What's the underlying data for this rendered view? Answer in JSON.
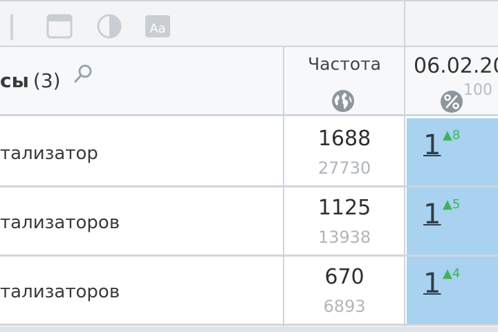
{
  "header": {
    "keywords_label": "сы",
    "keywords_count": "(3)",
    "frequency_label": "Частота",
    "date_label": "06.02.20",
    "percent_label": "100"
  },
  "rows": [
    {
      "keyword": "тализатор",
      "freq_main": "1688",
      "freq_sub": "27730",
      "position": "1",
      "delta": "▲8"
    },
    {
      "keyword": "тализаторов",
      "freq_main": "1125",
      "freq_sub": "13938",
      "position": "1",
      "delta": "▲5"
    },
    {
      "keyword": "тализаторов",
      "freq_main": "670",
      "freq_sub": "6893",
      "position": "1",
      "delta": "▲4"
    }
  ],
  "icons": {
    "toolbar": [
      "window-icon",
      "contrast-icon",
      "font-size-icon"
    ],
    "search": "search-icon",
    "frequency": "globe-icon",
    "percent": "percent-icon"
  },
  "colors": {
    "position_cell": "#a8d2f0",
    "delta_up": "#3cb45a",
    "border": "#cfd5db"
  }
}
